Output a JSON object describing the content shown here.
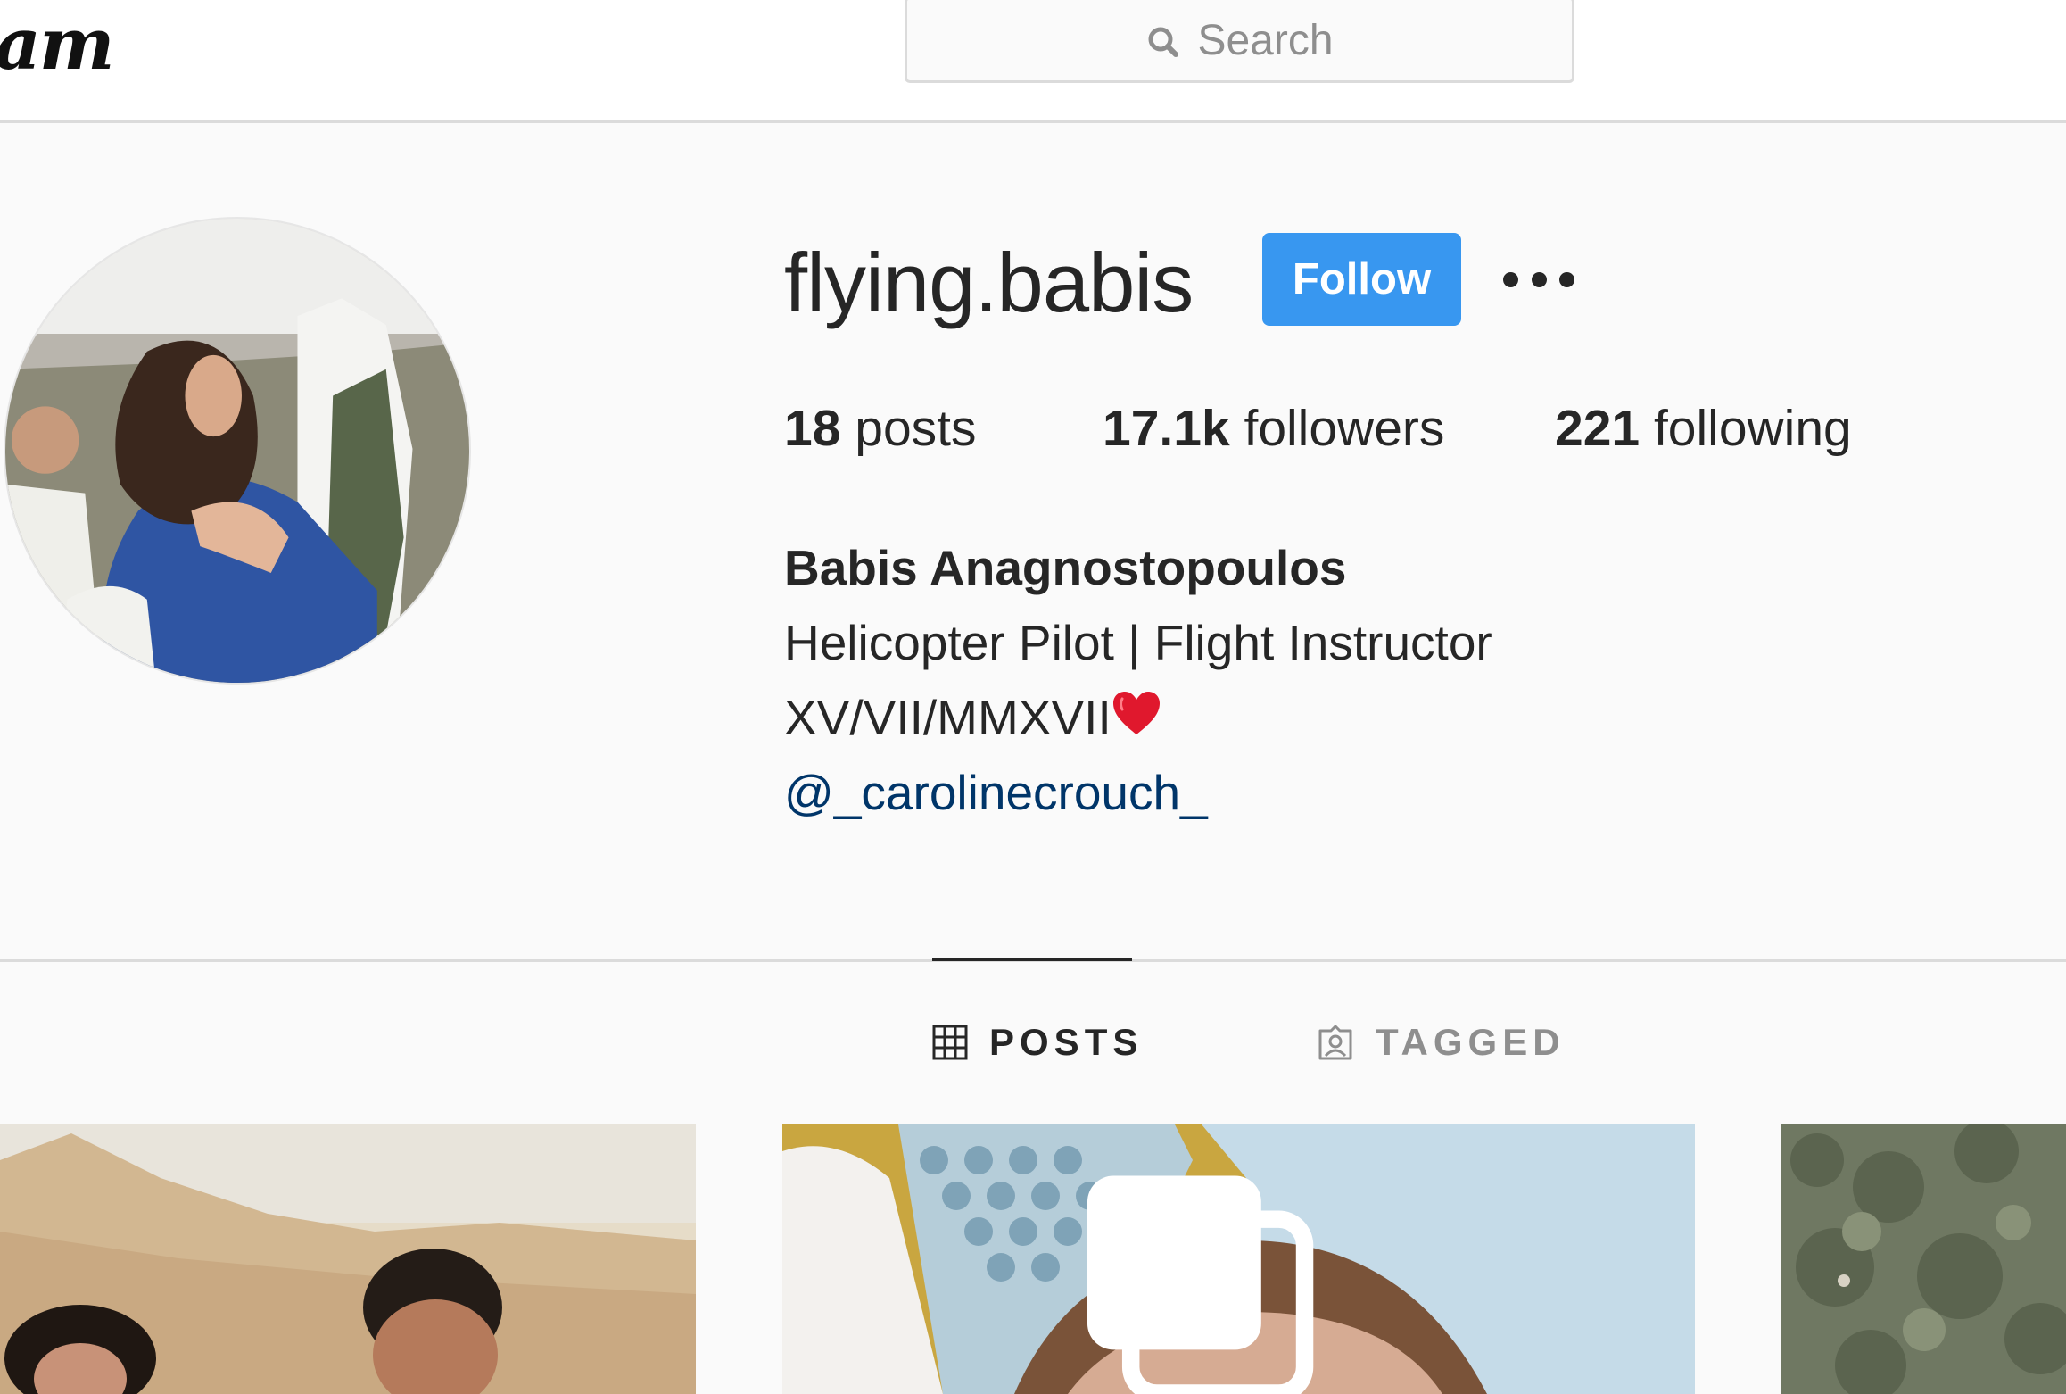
{
  "brand": {
    "logo_text": "am"
  },
  "search": {
    "placeholder": "Search"
  },
  "profile": {
    "username": "flying.babis",
    "follow_label": "Follow",
    "stats": {
      "posts_count": "18",
      "posts_label": "posts",
      "followers_count": "17.1k",
      "followers_label": "followers",
      "following_count": "221",
      "following_label": "following"
    },
    "bio": {
      "full_name": "Babis Anagnostopoulos",
      "line1": "Helicopter Pilot | Flight Instructor",
      "line2": "XV/VII/MMXVII",
      "mention": "@_carolinecrouch_"
    }
  },
  "tabs": [
    {
      "label": "POSTS",
      "active": true
    },
    {
      "label": "TAGGED",
      "active": false
    }
  ],
  "colors": {
    "accent": "#3897f0",
    "link": "#003569",
    "muted": "#8e8e8e",
    "text": "#262626",
    "border": "#dbdbdb"
  },
  "icons": [
    "search-icon",
    "more-options-icon",
    "grid-icon",
    "tagged-icon",
    "heart-emoji-icon",
    "multiple-posts-icon"
  ]
}
